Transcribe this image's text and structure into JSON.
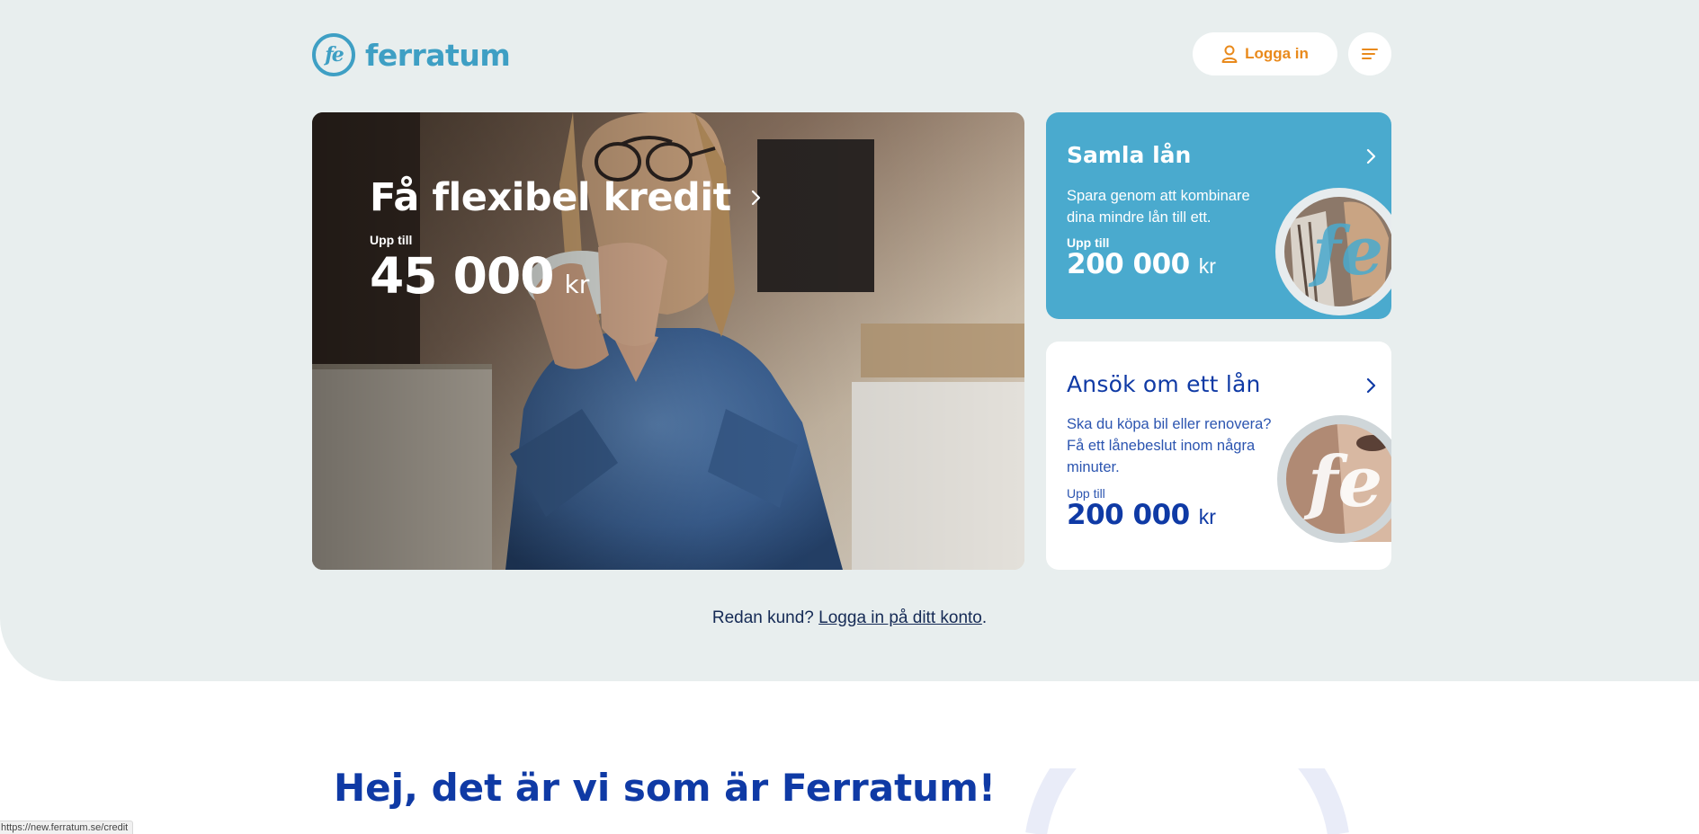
{
  "header": {
    "logo_mark": "fe",
    "logo_text": "ferratum",
    "login_label": "Logga in",
    "login_icon": "user-icon",
    "menu_icon": "menu-lines-icon"
  },
  "hero": {
    "title": "Få flexibel kredit",
    "upp_till": "Upp till",
    "amount": "45 000",
    "currency": "kr",
    "chevron_icon": "chevron-right-icon"
  },
  "samla": {
    "title": "Samla lån",
    "description": "Spara genom att kombinare dina mindre lån till ett.",
    "upp_till": "Upp till",
    "amount": "200 000",
    "currency": "kr",
    "chevron_icon": "chevron-right-icon"
  },
  "ansok": {
    "title": "Ansök om ett lån",
    "description": "Ska du köpa bil eller renovera? Få ett lånebeslut inom några minuter.",
    "upp_till": "Upp till",
    "amount": "200 000",
    "currency": "kr",
    "chevron_icon": "chevron-right-icon"
  },
  "customer": {
    "prefix": "Redan kund? ",
    "link": "Logga in på ditt konto",
    "suffix": "."
  },
  "about": {
    "heading": "Hej, det är vi som är Ferratum!"
  },
  "status_bar": {
    "url": "https://new.ferratum.se/credit"
  },
  "colors": {
    "brand_teal": "#3e9fc4",
    "accent_orange": "#e98a1c",
    "navy": "#0f3aa5",
    "hero_bg": "#e8eeee",
    "samla_card": "#4aaace"
  }
}
